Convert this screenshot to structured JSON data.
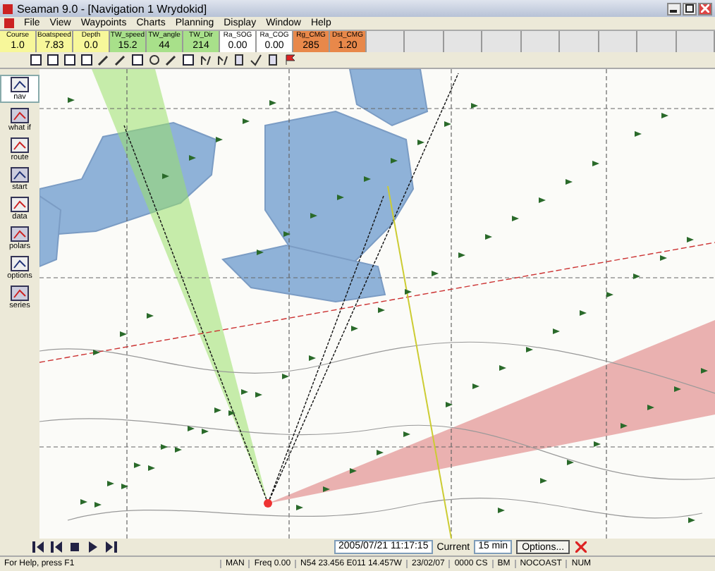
{
  "window": {
    "title": "Seaman 9.0 - [Navigation 1 Wrydokid]"
  },
  "menu": [
    "File",
    "View",
    "Waypoints",
    "Charts",
    "Planning",
    "Display",
    "Window",
    "Help"
  ],
  "instruments": [
    {
      "label": "Course",
      "value": "1.0",
      "color": "#f7f79a"
    },
    {
      "label": "Boatspeed",
      "value": "7.83",
      "color": "#f7f79a"
    },
    {
      "label": "Depth",
      "value": "0.0",
      "color": "#f7f79a"
    },
    {
      "label": "TW_speed",
      "value": "15.2",
      "color": "#a8e08a"
    },
    {
      "label": "TW_angle",
      "value": "44",
      "color": "#a8e08a"
    },
    {
      "label": "TW_Dir",
      "value": "214",
      "color": "#a8e08a"
    },
    {
      "label": "Ra_SOG",
      "value": "0.00",
      "color": "#ffffff"
    },
    {
      "label": "Ra_COG",
      "value": "0.00",
      "color": "#ffffff"
    },
    {
      "label": "Rg_CMG",
      "value": "285",
      "color": "#e8884a"
    },
    {
      "label": "Dst_CMG",
      "value": "1.20",
      "color": "#e8884a"
    }
  ],
  "sidebar": [
    {
      "label": "nav",
      "selected": true
    },
    {
      "label": "what if",
      "selected": false
    },
    {
      "label": "route",
      "selected": false
    },
    {
      "label": "start",
      "selected": false
    },
    {
      "label": "data",
      "selected": false
    },
    {
      "label": "polars",
      "selected": false
    },
    {
      "label": "options",
      "selected": false
    },
    {
      "label": "series",
      "selected": false
    }
  ],
  "playback": {
    "time": "2005/07/21 11:17:15",
    "current_label": "Current",
    "interval": "15 min",
    "options_button": "Options..."
  },
  "status_bar": [
    "For Help, press F1",
    "MAN",
    "Freq 0.00",
    "N54 23.456 E011 14.457W",
    "23/02/07",
    "0000 CS",
    "BM",
    "NOCOAST",
    "NUM"
  ]
}
